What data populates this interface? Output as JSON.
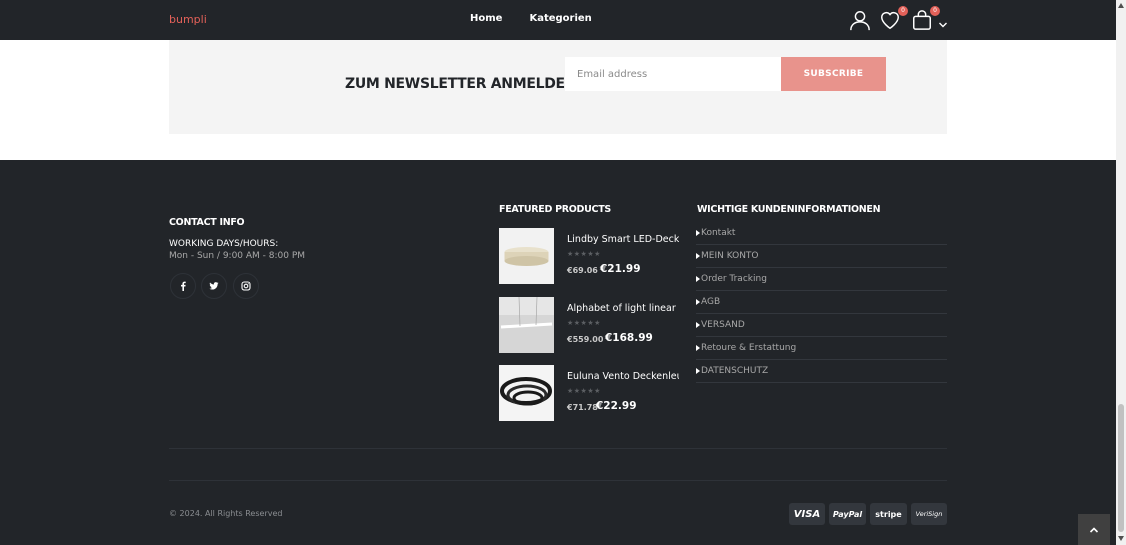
{
  "header": {
    "logo": "bumpli",
    "nav": [
      "Home",
      "Kategorien"
    ],
    "wishlist_count": "0",
    "cart_count": "0"
  },
  "newsletter": {
    "title": "ZUM NEWSLETTER ANMELDEN",
    "placeholder": "Email address",
    "button": "SUBSCRIBE"
  },
  "contact": {
    "title": "CONTACT INFO",
    "hours_label": "WORKING DAYS/HOURS:",
    "hours": "Mon - Sun / 9:00 AM - 8:00 PM"
  },
  "featured": {
    "title": "FEATURED PRODUCTS",
    "stars": "★★★★★",
    "products": [
      {
        "name": "Lindby Smart LED-Deckenleuchte",
        "old_price": "€69.06",
        "price": "€21.99"
      },
      {
        "name": "Alphabet of light linear LED",
        "old_price": "€559.00",
        "price": "€168.99"
      },
      {
        "name": "Euluna Vento Deckenleuchte",
        "old_price": "€71.78",
        "price": "€22.99"
      }
    ]
  },
  "info": {
    "title": "WICHTIGE KUNDENINFORMATIONEN",
    "links": [
      "Kontakt",
      "MEIN KONTO",
      "Order Tracking",
      "AGB",
      "VERSAND",
      "Retoure & Erstattung",
      "DATENSCHUTZ"
    ]
  },
  "footer": {
    "copyright": "© 2024. All Rights Reserved",
    "payments": [
      "VISA",
      "PayPal",
      "stripe",
      "VeriSign"
    ]
  }
}
